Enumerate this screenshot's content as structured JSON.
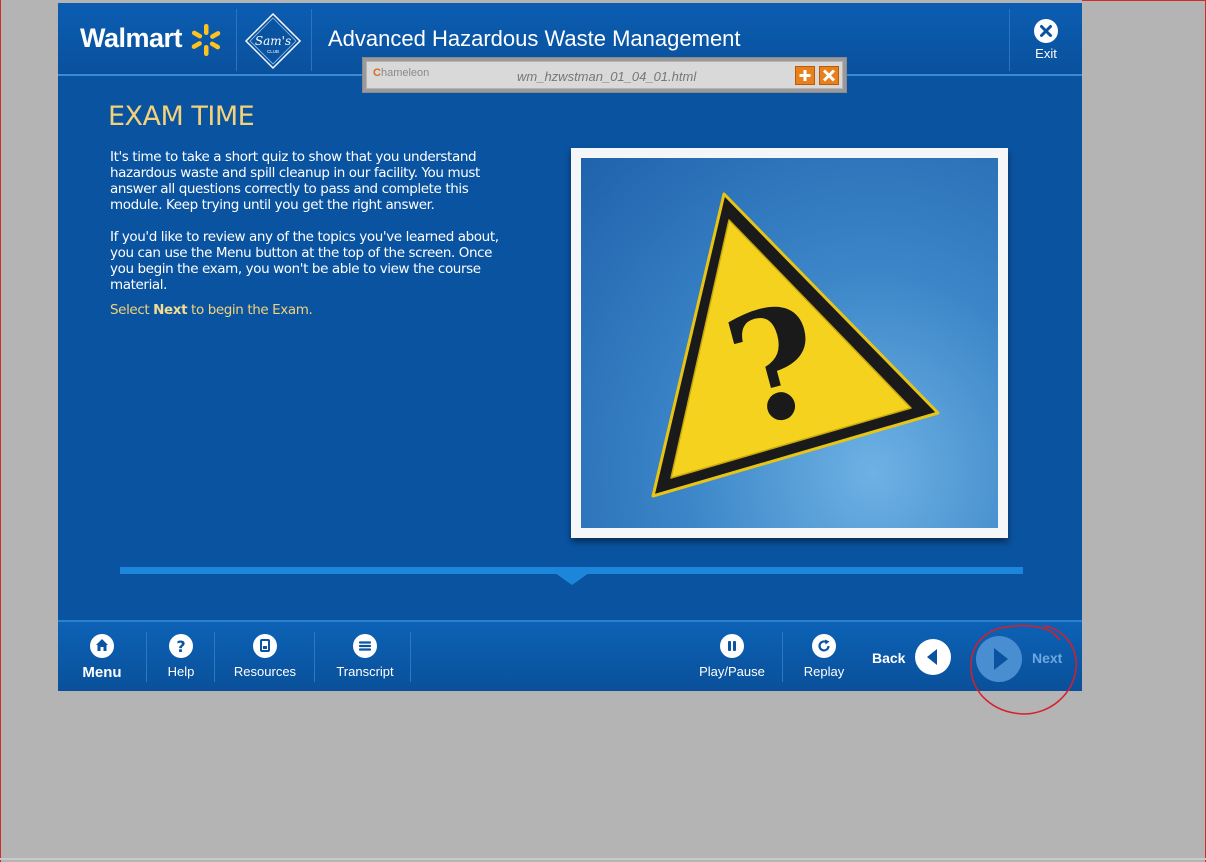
{
  "header": {
    "brand": "Walmart",
    "sams_club_text": "Sam's",
    "sams_club_sub": "CLUB",
    "title": "Advanced Hazardous Waste Management",
    "exit_label": "Exit"
  },
  "chameleon": {
    "brand": "hameleon",
    "brand_initial": "C",
    "filename": "wm_hzwstman_01_04_01.html"
  },
  "content": {
    "heading": "EXAM TIME",
    "paragraph1": "It's time to take a short quiz to show that you understand hazardous waste and spill cleanup in our facility.  You must answer all questions correctly to pass and complete this module.  Keep trying until you get the right answer.",
    "paragraph2": "If you'd like to review any of the topics you've learned about, you can use the Menu button at the top of the screen.  Once you begin the exam, you won't be able to view the course material.",
    "instruction_prefix": "Select ",
    "instruction_bold": "Next",
    "instruction_suffix": " to begin the Exam.",
    "image_symbol": "?"
  },
  "footer": {
    "menu": "Menu",
    "help": "Help",
    "resources": "Resources",
    "transcript": "Transcript",
    "play_pause": "Play/Pause",
    "replay": "Replay",
    "back": "Back",
    "next": "Next"
  },
  "icons": {
    "menu": "home-icon",
    "help": "question-icon",
    "resources": "document-icon",
    "transcript": "list-icon",
    "play_pause": "pause-icon",
    "replay": "replay-icon",
    "back": "back-arrow-icon",
    "next": "next-arrow-icon",
    "exit": "close-icon"
  },
  "colors": {
    "primary_blue": "#0a53a0",
    "accent_gold": "#f2d27a",
    "annotation_red": "#d81f2a",
    "warning_yellow": "#f5d21e"
  }
}
